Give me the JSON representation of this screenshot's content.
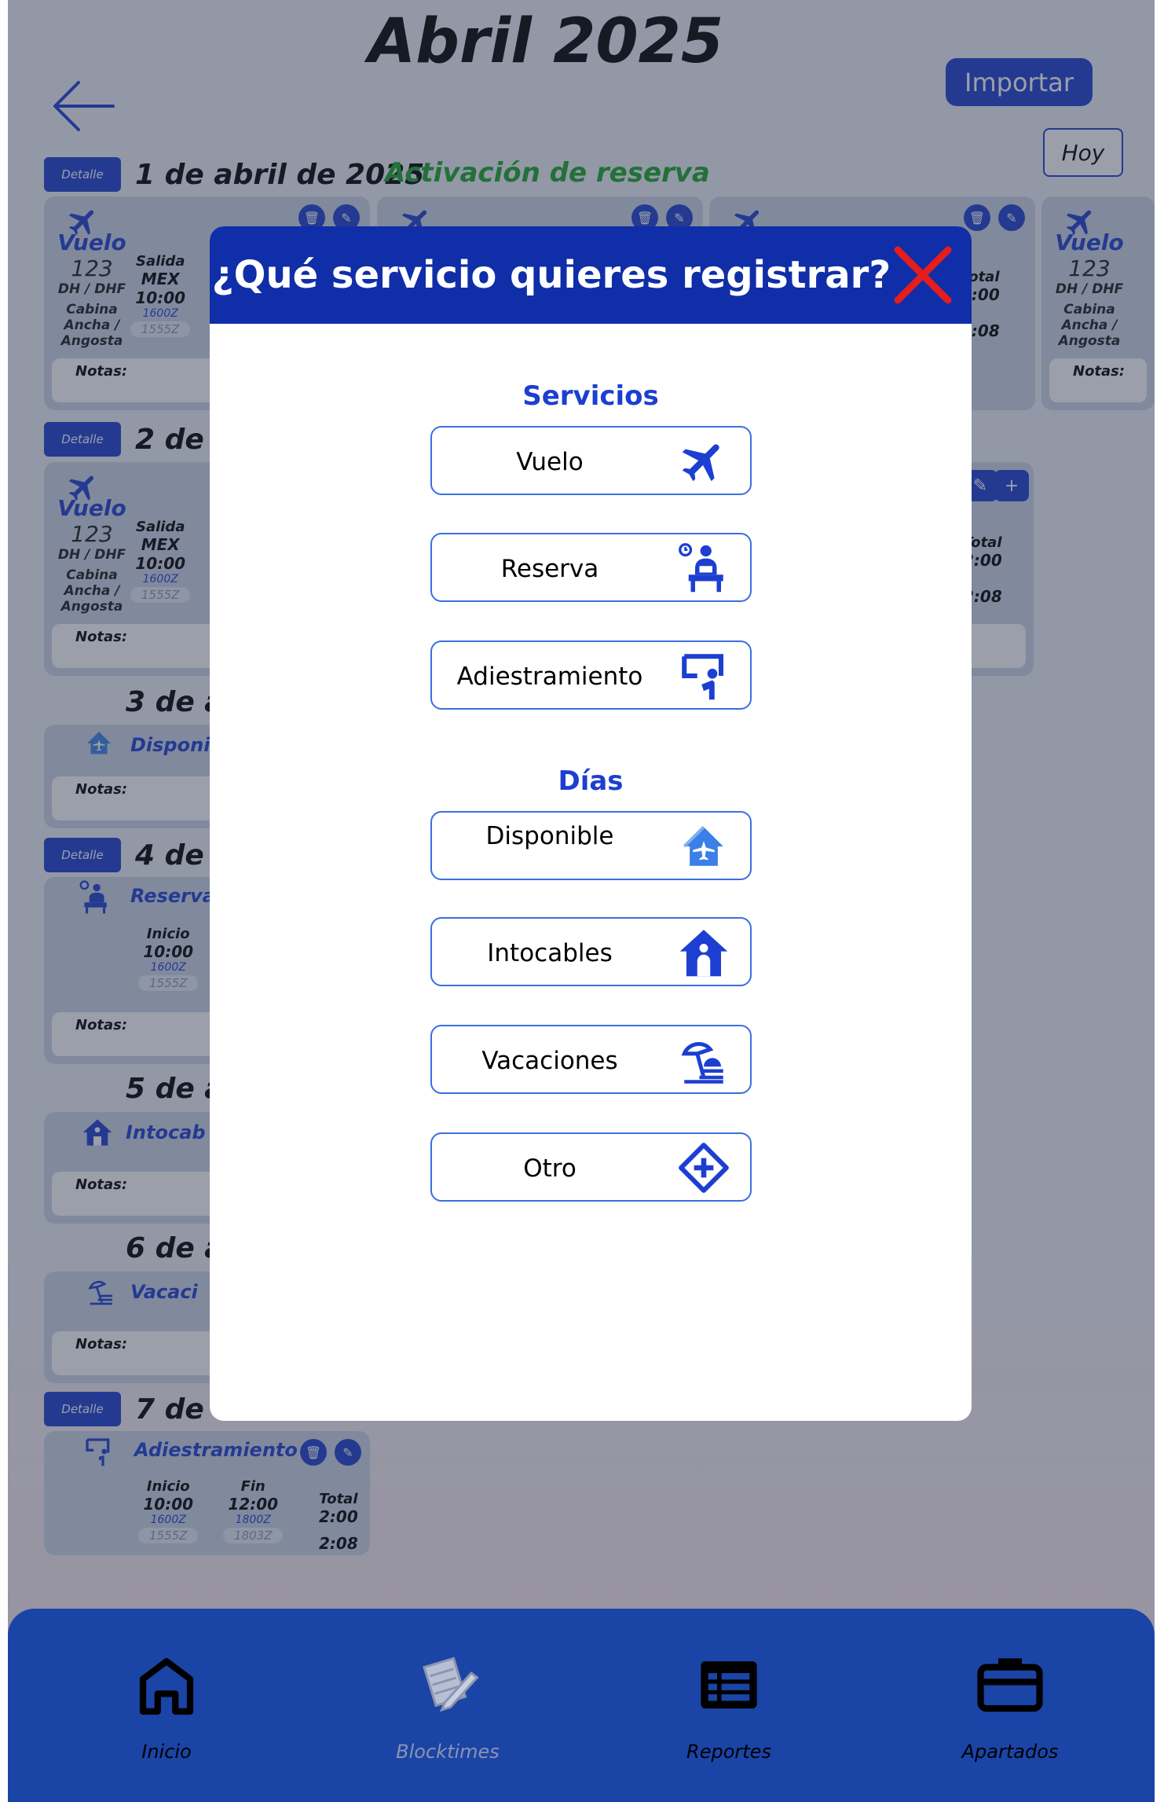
{
  "header": {
    "month_title": "Abril 2025",
    "import_label": "Importar",
    "today_label": "Hoy",
    "activation_label": "Activación de reserva"
  },
  "days": {
    "detalle_label": "Detalle",
    "d1": "1 de abril de 2025",
    "d2": "2 de a",
    "d3": "3 de a",
    "d4": "4 de a",
    "d5": "5 de a",
    "d6": "6 de a",
    "d7": "7 de a"
  },
  "cards": {
    "notes_label": "Notas:",
    "flight": {
      "kind": "Vuelo",
      "number": "123",
      "route": "DH / DHF",
      "cabin": "Cabina Ancha / Angosta",
      "depart_label": "Salida",
      "depart_code": "MEX",
      "depart_time": "10:00",
      "depart_z": "1600Z",
      "depart_pill": "1555Z",
      "total_label": "Total",
      "total_value": "2:00",
      "total_block": "2:08"
    },
    "available_kind": "Disponi",
    "reserve_kind": "Reserva",
    "reserve_start_label": "Inicio",
    "reserve_start_time": "10:00",
    "reserve_start_z": "1600Z",
    "reserve_start_pill": "1555Z",
    "untouchable_kind": "Intocab",
    "vacation_kind": "Vacaci",
    "training": {
      "kind": "Adiestramiento",
      "start_label": "Inicio",
      "start_time": "10:00",
      "start_z": "1600Z",
      "start_pill": "1555Z",
      "end_label": "Fin",
      "end_time": "12:00",
      "end_z": "1800Z",
      "end_pill": "1803Z",
      "total_label": "Total",
      "total_value": "2:00",
      "total_block": "2:08"
    }
  },
  "modal": {
    "title": "¿Qué servicio quieres registrar?",
    "services_heading": "Servicios",
    "days_heading": "Días",
    "services": [
      {
        "label": "Vuelo",
        "icon": "airplane-icon"
      },
      {
        "label": "Reserva",
        "icon": "reserve-seat-icon"
      },
      {
        "label": "Adiestramiento",
        "icon": "training-board-icon"
      }
    ],
    "day_types": [
      {
        "label": "Disponible",
        "icon": "home-airplane-icon"
      },
      {
        "label": "Intocables",
        "icon": "house-icon"
      },
      {
        "label": "Vacaciones",
        "icon": "beach-umbrella-icon"
      },
      {
        "label": "Otro",
        "icon": "diamond-plus-icon"
      }
    ],
    "colors": {
      "header": "#0f2ea8",
      "accent": "#1c3fd1",
      "close": "#e51d1d"
    }
  },
  "nav": {
    "items": [
      {
        "label": "Inicio",
        "icon": "home-icon"
      },
      {
        "label": "Blocktimes",
        "icon": "notepad-pencil-icon"
      },
      {
        "label": "Reportes",
        "icon": "table-icon"
      },
      {
        "label": "Apartados",
        "icon": "briefcase-icon"
      }
    ]
  }
}
